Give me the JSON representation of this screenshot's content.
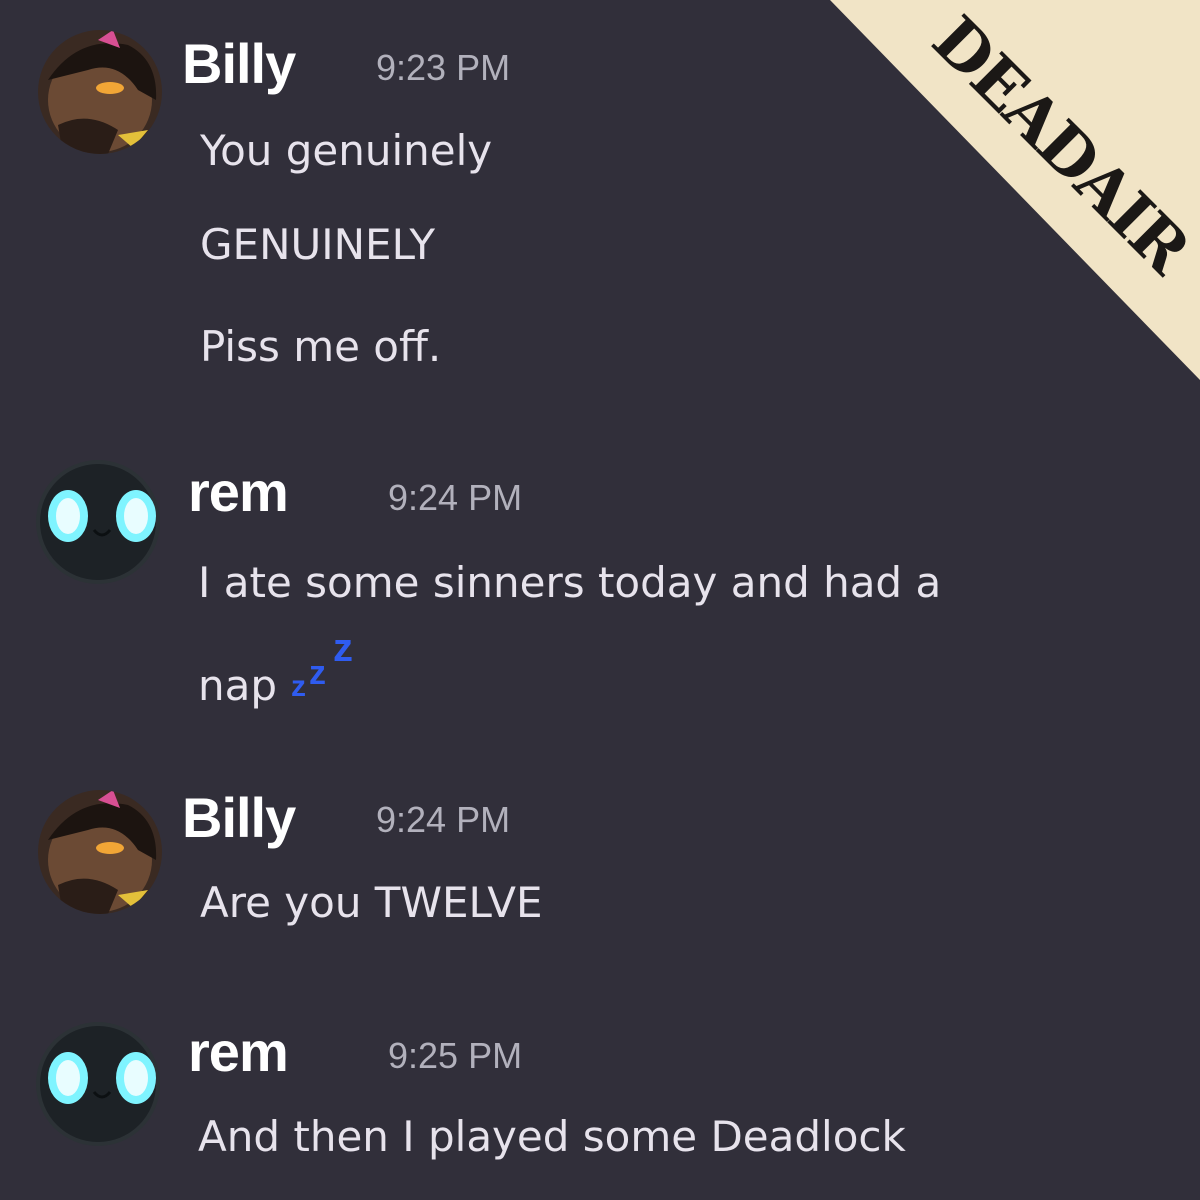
{
  "watermark": {
    "text": "DEADAIR"
  },
  "messages": [
    {
      "author": "Billy",
      "time": "9:23 PM",
      "avatar_icon": "billy-avatar-icon",
      "lines": [
        "You genuinely",
        "GENUINELY",
        "Piss me off."
      ]
    },
    {
      "author": "rem",
      "time": "9:24 PM",
      "avatar_icon": "rem-avatar-icon",
      "lines": [
        "I ate some sinners today and had a",
        "nap"
      ],
      "emoji": "zzz-emoji"
    },
    {
      "author": "Billy",
      "time": "9:24 PM",
      "avatar_icon": "billy-avatar-icon",
      "lines": [
        "Are you TWELVE"
      ]
    },
    {
      "author": "rem",
      "time": "9:25 PM",
      "avatar_icon": "rem-avatar-icon",
      "lines": [
        "And then I played some Deadlock"
      ]
    }
  ],
  "colors": {
    "background": "#312f3a",
    "username": "#ffffff",
    "timestamp": "#b2b1bc",
    "message": "#e7e3ec",
    "banner": "#f1e4c6",
    "zzz": "#2f5cf0",
    "rem_eyes": "#7ff4ff"
  }
}
